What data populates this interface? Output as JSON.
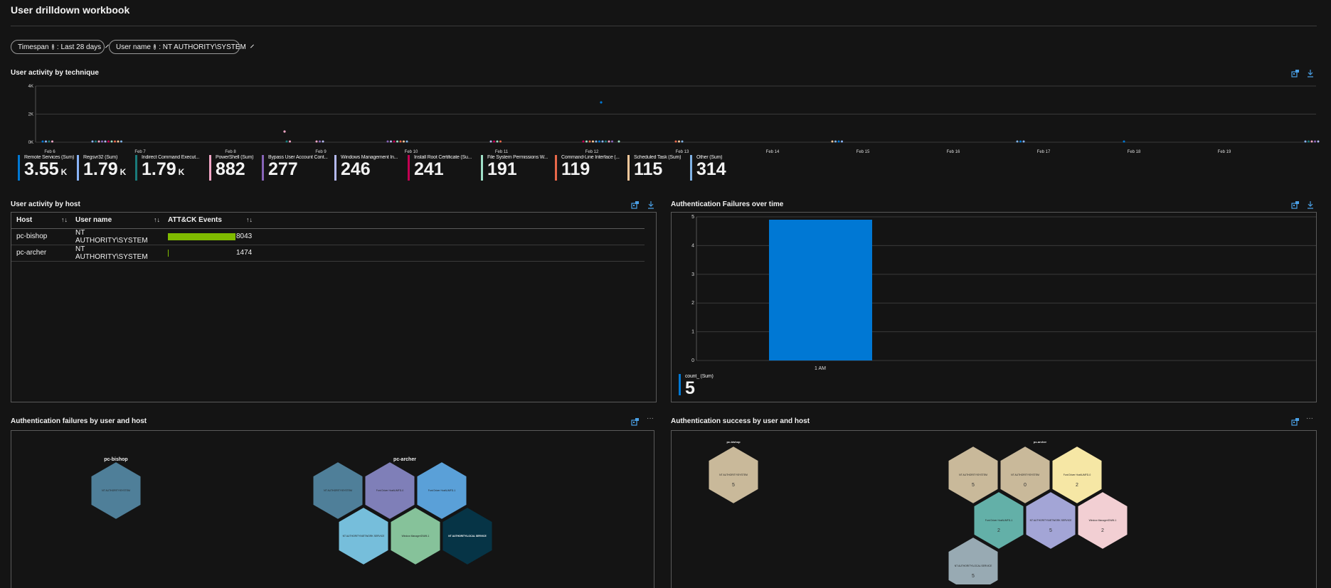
{
  "page": {
    "title": "User drilldown workbook"
  },
  "params": {
    "timespan_label": "Timespan",
    "timespan_value": ": Last 28 days",
    "username_label": "User name",
    "username_value": ": NT AUTHORITY\\SYSTEM"
  },
  "technique": {
    "title": "User activity by technique",
    "y_ticks": [
      "4K",
      "2K",
      "0K"
    ],
    "x_ticks": [
      "Feb 6",
      "Feb 7",
      "Feb 8",
      "Feb 9",
      "Feb 10",
      "Feb 11",
      "Feb 12",
      "Feb 13",
      "Feb 14",
      "Feb 15",
      "Feb 16",
      "Feb 17",
      "Feb 18",
      "Feb 19"
    ],
    "tiles": [
      {
        "label": "Remote Services (Sum)",
        "value": "3.55",
        "unit": "K",
        "color": "#0078d4"
      },
      {
        "label": "Regsvr32 (Sum)",
        "value": "1.79",
        "unit": "K",
        "color": "#8ab4f8"
      },
      {
        "label": "Indirect Command Execut...",
        "value": "1.79",
        "unit": "K",
        "color": "#1a7a7a"
      },
      {
        "label": "PowerShell (Sum)",
        "value": "882",
        "unit": "",
        "color": "#f4a6c6"
      },
      {
        "label": "Bypass User Account Cont...",
        "value": "277",
        "unit": "",
        "color": "#8764b8"
      },
      {
        "label": "Windows Management In...",
        "value": "246",
        "unit": "",
        "color": "#b4b9f0"
      },
      {
        "label": "Install Root Certificate (Su...",
        "value": "241",
        "unit": "",
        "color": "#c30052"
      },
      {
        "label": "File System Permissions W...",
        "value": "191",
        "unit": "",
        "color": "#9fe0c8"
      },
      {
        "label": "Command-Line Interface (...",
        "value": "119",
        "unit": "",
        "color": "#e8684a"
      },
      {
        "label": "Scheduled Task (Sum)",
        "value": "115",
        "unit": "",
        "color": "#f7c89b"
      },
      {
        "label": "Other (Sum)",
        "value": "314",
        "unit": "",
        "color": "#7fb2e5"
      }
    ]
  },
  "host_table": {
    "title": "User activity by host",
    "columns": [
      "Host",
      "User name",
      "ATT&CK Events"
    ],
    "sort_glyph": "↑↓",
    "rows": [
      {
        "host": "pc-bishop",
        "user": "NT AUTHORITY\\SYSTEM",
        "events": "8043",
        "fraction": 1.0
      },
      {
        "host": "pc-archer",
        "user": "NT AUTHORITY\\SYSTEM",
        "events": "1474",
        "fraction": 0.0
      }
    ]
  },
  "auth_failures_time": {
    "title": "Authentication Failures over time",
    "y_ticks": [
      "5",
      "4",
      "3",
      "2",
      "1",
      "0"
    ],
    "ymax": 5,
    "x_tick": "1 AM",
    "value": 5,
    "legend_label": "count_ (Sum)",
    "legend_value": "5",
    "color": "#0078d4"
  },
  "failures_hex": {
    "title": "Authentication failures by user and host",
    "group1": "pc-bishop",
    "group2": "pc-archer",
    "cells": [
      {
        "label": "NT AUTHORITY\\SYSTEM",
        "color": "#4f7f99"
      },
      {
        "label": "NT AUTHORITY\\SYSTEM",
        "color": "#4f7f99"
      },
      {
        "label": "Font Driver Host\\UMFD-0",
        "color": "#7f7fb8"
      },
      {
        "label": "Font Driver Host\\UMFD-1",
        "color": "#5aa0d8"
      },
      {
        "label": "NT AUTHORITY\\NETWORK SERVICE",
        "color": "#76bedb"
      },
      {
        "label": "Window Manager\\DWM-1",
        "color": "#86c29a"
      },
      {
        "label": "NT AUTHORITY\\LOCAL SERVICE",
        "color": "#063446"
      }
    ]
  },
  "success_hex": {
    "title": "Authentication success by user and host",
    "group1": "pc-bishop",
    "group2": "pc-archer",
    "cells": [
      {
        "label": "NT AUTHORITY\\SYSTEM",
        "count": "5",
        "color": "#c9b99a"
      },
      {
        "label": "NT AUTHORITY\\SYSTEM",
        "count": "5",
        "color": "#c9b99a"
      },
      {
        "label": "NT AUTHORITY\\SYSTEM",
        "count": "0",
        "color": "#c9b99a"
      },
      {
        "label": "Font Driver Host\\UMFD-0",
        "count": "2",
        "color": "#f6e7a5"
      },
      {
        "label": "Font Driver Host\\UMFD-1",
        "count": "2",
        "color": "#63b0a8"
      },
      {
        "label": "NT AUTHORITY\\NETWORK SERVICE",
        "count": "5",
        "color": "#a3a5d6"
      },
      {
        "label": "Window Manager\\DWM-1",
        "count": "2",
        "color": "#f2cfd3"
      },
      {
        "label": "NT AUTHORITY\\LOCAL SERVICE",
        "count": "5",
        "color": "#98aab3"
      }
    ]
  }
}
